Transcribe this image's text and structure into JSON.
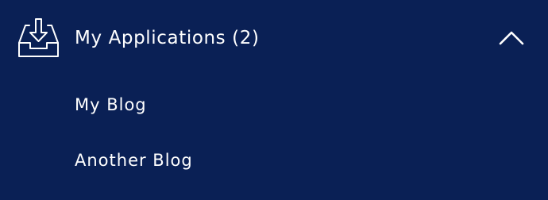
{
  "menu": {
    "header": {
      "title": "My Applications (2)",
      "icon": "inbox-download-icon",
      "toggle_icon": "chevron-up-icon"
    },
    "items": [
      {
        "label": "My Blog"
      },
      {
        "label": "Another Blog"
      }
    ]
  },
  "colors": {
    "background": "#0a2055",
    "text": "#ffffff"
  }
}
